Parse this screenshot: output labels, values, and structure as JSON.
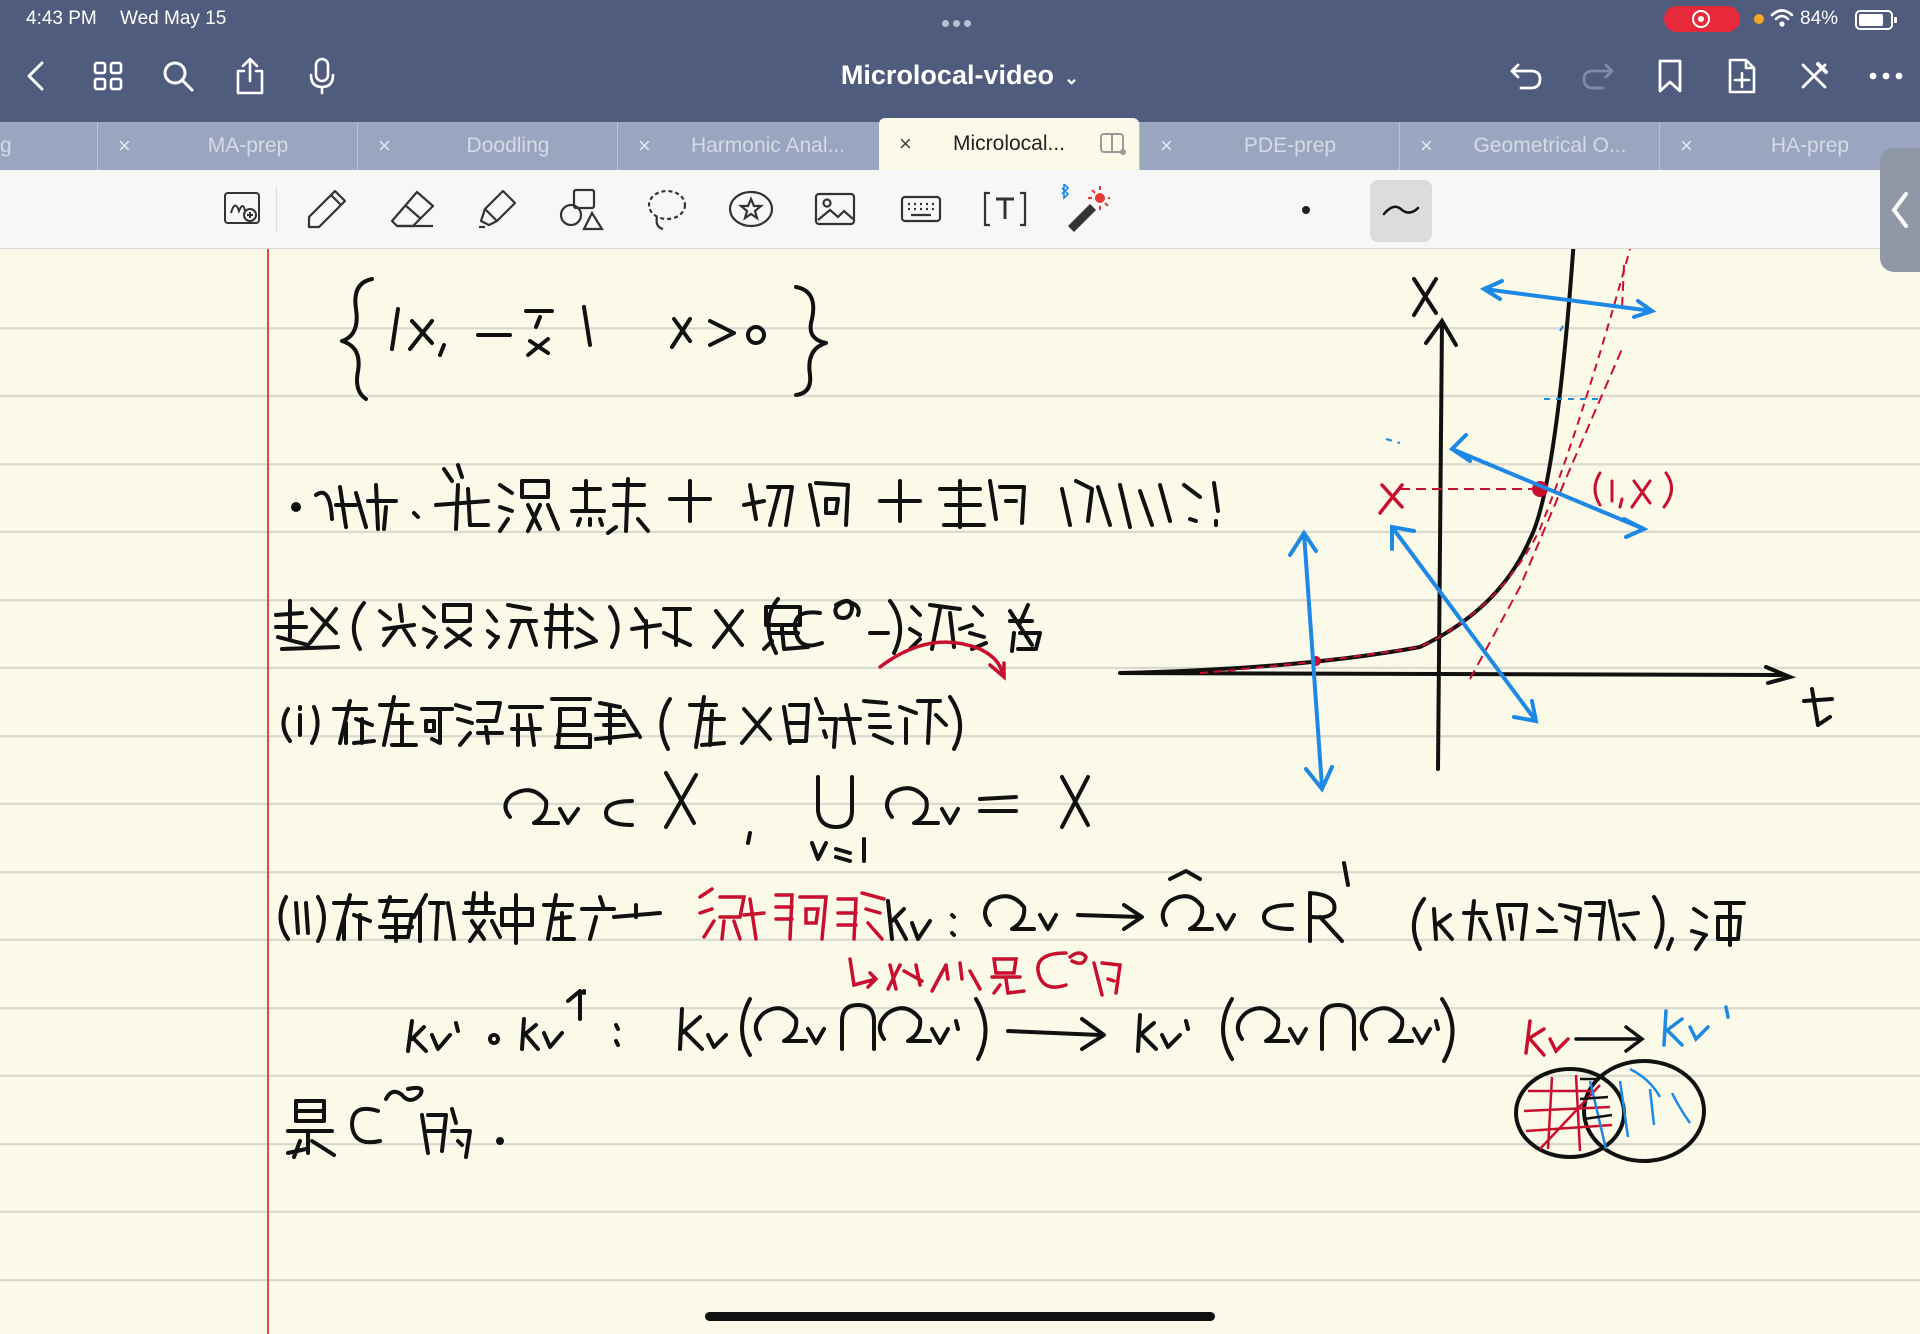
{
  "status_bar": {
    "time": "4:43 PM",
    "date": "Wed May 15",
    "battery": "84%"
  },
  "header": {
    "title": "Microlocal-video",
    "chevron": "chevron-down-icon",
    "left_icons": [
      "back-icon",
      "grid-icon",
      "search-icon",
      "share-icon",
      "microphone-icon"
    ],
    "right_icons": [
      "undo-icon",
      "redo-icon",
      "bookmark-icon",
      "add-page-icon",
      "close-pen-icon",
      "more-icon"
    ]
  },
  "tabs": [
    {
      "label": "g",
      "close": ""
    },
    {
      "label": "MA-prep",
      "close": "×"
    },
    {
      "label": "Doodling",
      "close": "×"
    },
    {
      "label": "Harmonic Anal...",
      "close": "×"
    },
    {
      "label": "Microlocal...",
      "close": "×",
      "active": true
    },
    {
      "label": "PDE-prep",
      "close": "×"
    },
    {
      "label": "Geometrical O...",
      "close": "×"
    },
    {
      "label": "HA-prep",
      "close": "×"
    }
  ],
  "toolbar": {
    "tools": [
      "zoom-write-icon",
      "pen-icon",
      "eraser-icon",
      "highlighter-icon",
      "shapes-icon",
      "lasso-icon",
      "sticker-icon",
      "image-icon",
      "keyboard-icon",
      "text-icon",
      "laser-pointer-icon"
    ]
  },
  "colors": {
    "header_bg": "#4f5c7d",
    "tab_bg": "#9aa6c0",
    "paper": "#fbf9e8",
    "margin": "#e0484a",
    "ink_black": "#111111",
    "ink_red": "#c8102e",
    "ink_blue": "#1e88e5"
  }
}
